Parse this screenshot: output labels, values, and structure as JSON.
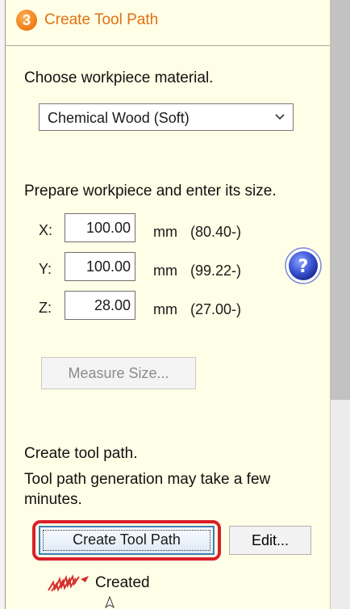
{
  "header": {
    "step_number": "3",
    "title": "Create Tool Path"
  },
  "material": {
    "prompt": "Choose workpiece material.",
    "selected": "Chemical Wood (Soft)"
  },
  "size": {
    "prompt": "Prepare workpiece and enter its size.",
    "axes": [
      {
        "label": "X:",
        "value": "100.00",
        "unit": "mm",
        "hint": "(80.40-)"
      },
      {
        "label": "Y:",
        "value": "100.00",
        "unit": "mm",
        "hint": "(99.22-)"
      },
      {
        "label": "Z:",
        "value": "28.00",
        "unit": "mm",
        "hint": "(27.00-)"
      }
    ],
    "measure_button": "Measure Size..."
  },
  "toolpath": {
    "heading": "Create tool path.",
    "note_line1": "Tool path generation may take a few",
    "note_line2": "minutes.",
    "create_button": "Create Tool Path",
    "edit_button": "Edit...",
    "status": "Created"
  },
  "colors": {
    "panel_bg": "#fffee6",
    "header_title": "#e07010",
    "highlight": "#d8202a",
    "help_blue": "#2f46c8"
  },
  "icons": {
    "step": "step-badge-icon",
    "dropdown": "chevron-down-icon",
    "help": "help-icon",
    "status": "toolpath-created-icon",
    "cursor": "mouse-pointer-icon"
  }
}
